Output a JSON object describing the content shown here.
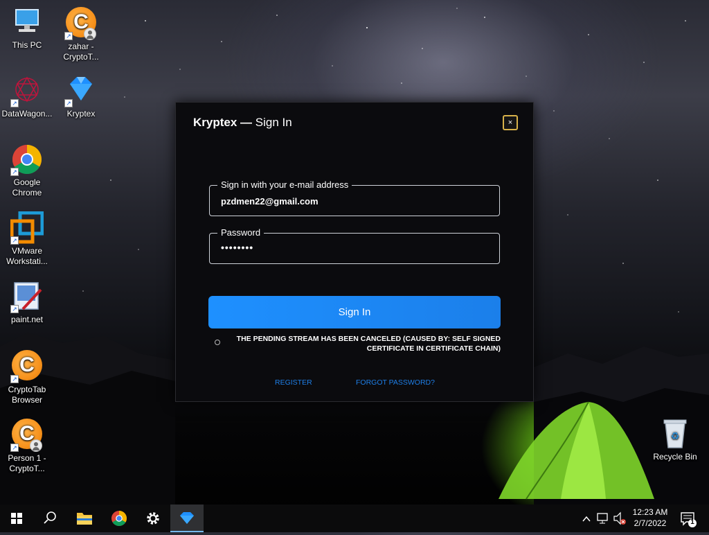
{
  "desktop": {
    "icons": [
      {
        "label": "This PC"
      },
      {
        "label": "zahar - CryptoT..."
      },
      {
        "label": "DataWagon..."
      },
      {
        "label": "Kryptex"
      },
      {
        "label": "Google Chrome"
      },
      {
        "label": "VMware Workstati..."
      },
      {
        "label": "paint.net"
      },
      {
        "label": "CryptoTab Browser"
      },
      {
        "label": "Person 1 - CryptoT..."
      },
      {
        "label": "Recycle Bin"
      }
    ]
  },
  "dialog": {
    "title_brand": "Kryptex",
    "title_sep": "—",
    "title_page": "Sign In",
    "close_glyph": "×",
    "email_legend": "Sign in with your e-mail address",
    "email_value": "pzdmen22@gmail.com",
    "password_legend": "Password",
    "password_value": "••••••••",
    "signin_label": "Sign In",
    "error_message": "THE PENDING STREAM HAS BEEN CANCELED (CAUSED BY: SELF SIGNED CERTIFICATE IN CERTIFICATE CHAIN)",
    "register_link": "REGISTER",
    "forgot_link": "FORGOT PASSWORD?"
  },
  "taskbar": {
    "time": "12:23 AM",
    "date": "2/7/2022",
    "notification_count": "1",
    "items": [
      "start-icon",
      "search-icon",
      "file-explorer-icon",
      "chrome-icon",
      "settings-icon",
      "kryptex-icon"
    ]
  },
  "colors": {
    "accent": "#1e90ff",
    "link": "#1e7fe8",
    "close_border": "#d8b24a"
  }
}
